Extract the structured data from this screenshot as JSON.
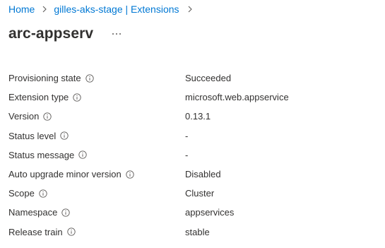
{
  "breadcrumb": {
    "items": [
      {
        "label": "Home"
      },
      {
        "label": "gilles-aks-stage | Extensions"
      }
    ],
    "separator_icon": "chevron-right-icon"
  },
  "header": {
    "title": "arc-appserv",
    "more_icon": "ellipsis-icon"
  },
  "properties": [
    {
      "label": "Provisioning state",
      "value": "Succeeded"
    },
    {
      "label": "Extension type",
      "value": "microsoft.web.appservice"
    },
    {
      "label": "Version",
      "value": "0.13.1"
    },
    {
      "label": "Status level",
      "value": "-"
    },
    {
      "label": "Status message",
      "value": "-"
    },
    {
      "label": "Auto upgrade minor version",
      "value": "Disabled"
    },
    {
      "label": "Scope",
      "value": "Cluster"
    },
    {
      "label": "Namespace",
      "value": "appservices"
    },
    {
      "label": "Release train",
      "value": "stable"
    }
  ],
  "colors": {
    "link": "#0078d4",
    "text": "#323130",
    "icon": "#605e5c"
  }
}
